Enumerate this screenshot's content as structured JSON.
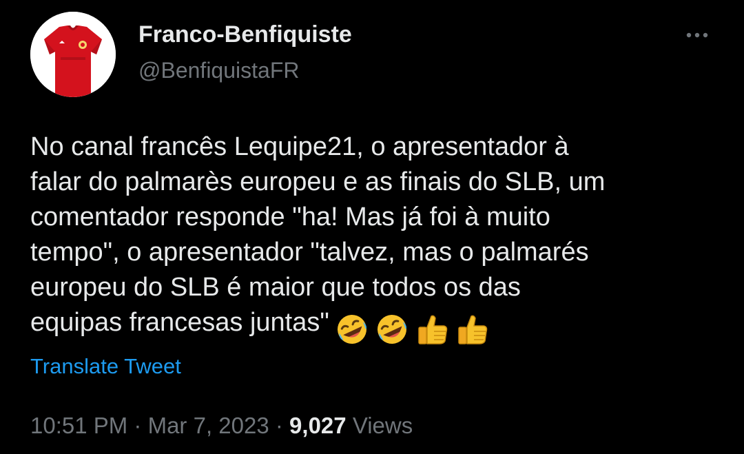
{
  "author": {
    "display_name": "Franco-Benfiquiste",
    "handle": "@BenfiquistaFR",
    "avatar_icon": "red-jersey-avatar"
  },
  "more_icon": "more-dots-icon",
  "tweet": {
    "lines": [
      "No canal francês Lequipe21, o apresentador à",
      "falar do palmarès europeu e as finais do SLB, um",
      "comentador responde \"ha! Mas já foi à muito",
      "tempo\", o apresentador \"talvez, mas o palmarés",
      "europeu do SLB é maior que todos os das",
      "equipas francesas juntas\""
    ],
    "emojis": [
      "rolling-on-floor-laughing-icon",
      "rolling-on-floor-laughing-icon",
      "thumbs-up-icon",
      "thumbs-up-icon"
    ]
  },
  "translate_label": "Translate Tweet",
  "meta": {
    "time": "10:51 PM",
    "separator": "·",
    "date": "Mar 7, 2023",
    "views_count": "9,027",
    "views_label": "Views"
  },
  "colors": {
    "background": "#000000",
    "text_primary": "#e7e9ea",
    "text_secondary": "#71767b",
    "link": "#1d9bf0"
  }
}
